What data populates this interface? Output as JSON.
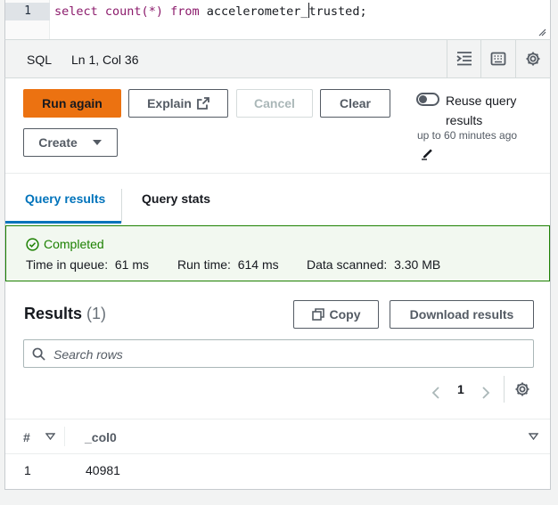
{
  "editor": {
    "line_number": "1",
    "code_keyword1": "select",
    "code_func": "count(*)",
    "code_keyword2": "from",
    "code_table_before_cursor": "accelerometer_",
    "code_table_after_cursor": "trusted;"
  },
  "statusbar": {
    "language": "SQL",
    "position": "Ln 1, Col 36",
    "icons": [
      "format-icon",
      "keyboard-icon",
      "settings-icon"
    ]
  },
  "actions": {
    "run_again": "Run again",
    "explain": "Explain",
    "cancel": "Cancel",
    "clear": "Clear",
    "create": "Create",
    "reuse_label": "Reuse query results",
    "reuse_sub": "up to 60 minutes ago",
    "reuse_enabled": false
  },
  "tabs": [
    {
      "label": "Query results",
      "active": true
    },
    {
      "label": "Query stats",
      "active": false
    }
  ],
  "status": {
    "state": "Completed",
    "time_in_queue_label": "Time in queue:",
    "time_in_queue": "61 ms",
    "run_time_label": "Run time:",
    "run_time": "614 ms",
    "data_scanned_label": "Data scanned:",
    "data_scanned": "3.30 MB"
  },
  "results": {
    "title": "Results",
    "count": "(1)",
    "copy": "Copy",
    "download": "Download results",
    "search_placeholder": "Search rows",
    "page": "1",
    "columns": [
      "#",
      "_col0"
    ],
    "rows": [
      [
        "1",
        "40981"
      ]
    ]
  },
  "colors": {
    "primary": "#ec7211",
    "link": "#0073bb",
    "success": "#1d8102"
  }
}
